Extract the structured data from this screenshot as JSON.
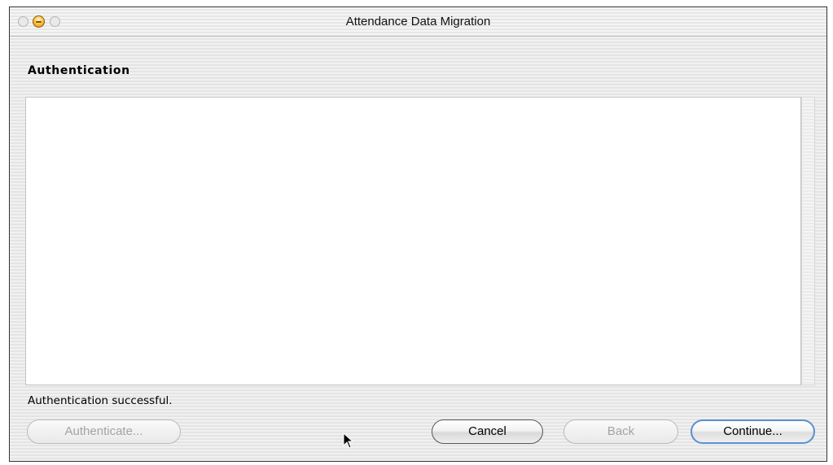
{
  "window": {
    "title": "Attendance Data Migration",
    "controls": {
      "close": "close-button",
      "minimize": "minimize-button",
      "zoom": "zoom-button"
    }
  },
  "page": {
    "heading": "Authentication",
    "status": "Authentication successful."
  },
  "buttons": {
    "authenticate": "Authenticate...",
    "cancel": "Cancel",
    "back": "Back",
    "continue": "Continue..."
  },
  "colors": {
    "default_button_ring": "#5b8fd0",
    "minimize_button": "#f0a21a",
    "disabled_text": "#a3a3a3"
  }
}
